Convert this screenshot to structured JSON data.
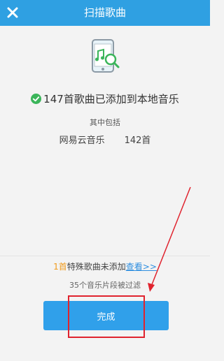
{
  "header": {
    "title": "扫描歌曲",
    "close_icon": "close-icon"
  },
  "scan_icon": "phone-music-search-icon",
  "result": {
    "status_icon": "check-circle-icon",
    "message": "147首歌曲已添加到本地音乐",
    "include_label": "其中包括",
    "sources": [
      {
        "name": "网易云音乐",
        "count": "142首"
      }
    ]
  },
  "special": {
    "count": "1首",
    "text": "特殊歌曲未添加",
    "link": "查看>>"
  },
  "filtered_text": "35个音乐片段被过滤",
  "done_button": "完成",
  "colors": {
    "header_bg": "#2fa0e2",
    "accent_orange": "#f09a1b",
    "link_blue": "#2f8fe0",
    "success_green": "#3bb55a",
    "annotation_red": "#e0232e"
  }
}
